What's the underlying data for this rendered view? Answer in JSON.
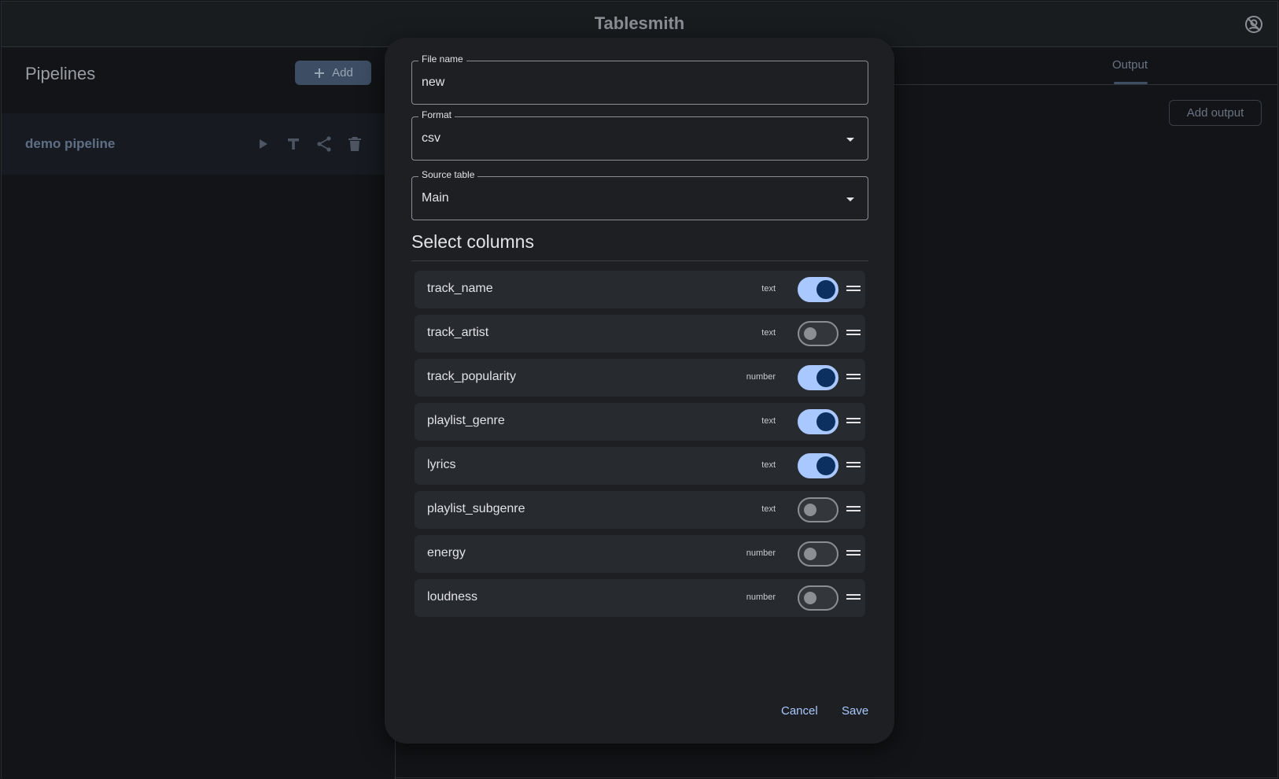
{
  "app": {
    "title": "Tablesmith"
  },
  "sidebar": {
    "title": "Pipelines",
    "add_label": "Add",
    "pipelines": [
      {
        "name": "demo pipeline"
      }
    ]
  },
  "main": {
    "tabs": [
      {
        "label": "Output",
        "active": true
      }
    ],
    "add_output_label": "Add output"
  },
  "dialog": {
    "file_name": {
      "label": "File name",
      "value": "new"
    },
    "format": {
      "label": "Format",
      "value": "csv"
    },
    "source_table": {
      "label": "Source table",
      "value": "Main"
    },
    "section_title": "Select columns",
    "columns": [
      {
        "name": "track_name",
        "type": "text",
        "enabled": true
      },
      {
        "name": "track_artist",
        "type": "text",
        "enabled": false
      },
      {
        "name": "track_popularity",
        "type": "number",
        "enabled": true
      },
      {
        "name": "playlist_genre",
        "type": "text",
        "enabled": true
      },
      {
        "name": "lyrics",
        "type": "text",
        "enabled": true
      },
      {
        "name": "playlist_subgenre",
        "type": "text",
        "enabled": false
      },
      {
        "name": "energy",
        "type": "number",
        "enabled": false
      },
      {
        "name": "loudness",
        "type": "number",
        "enabled": false
      }
    ],
    "cancel_label": "Cancel",
    "save_label": "Save"
  },
  "icons": {
    "account": "account-off-icon",
    "add": "plus-icon",
    "run": "play-icon",
    "text": "text-icon",
    "share": "share-icon",
    "delete": "trash-icon",
    "dropdown": "caret-down-icon",
    "drag": "drag-handle-icon"
  },
  "colors": {
    "accent": "#a8c8ff",
    "surface": "#1d1f22",
    "background": "#121417"
  }
}
